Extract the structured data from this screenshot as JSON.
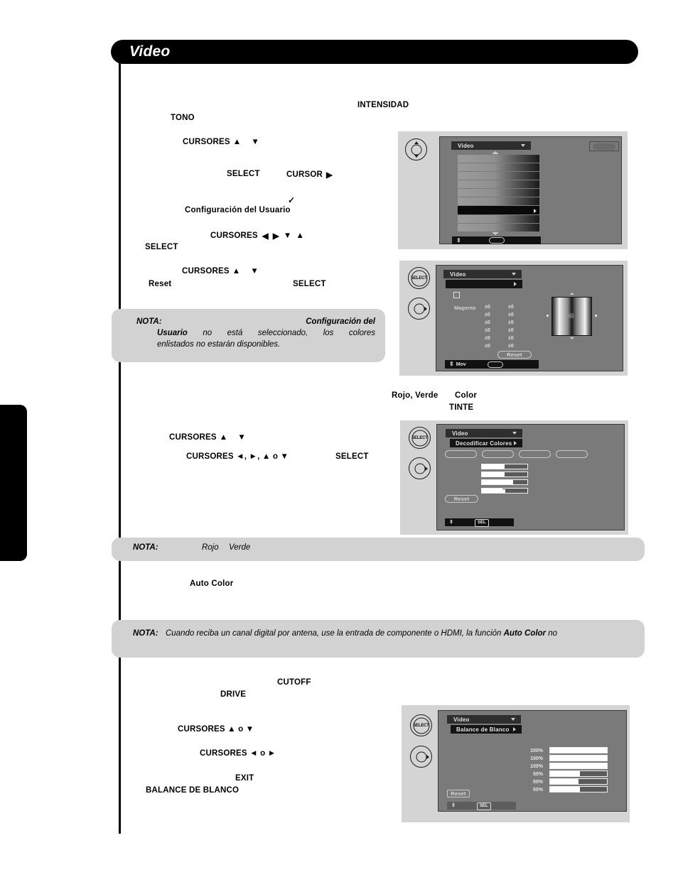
{
  "page": {
    "header_title": "Video"
  },
  "body_text": {
    "intensidad": "INTENSIDAD",
    "tono": "TONO",
    "cursores_ud_1": "CURSORES",
    "select_1": "SELECT",
    "cursor_right": "CURSOR",
    "check_mark": "✓",
    "config_usuario": "Configuración del Usuario",
    "cursores_lrdu": "CURSORES",
    "select_2": "SELECT",
    "cursores_ud_2": "CURSORES",
    "reset": "Reset",
    "select_3": "SELECT",
    "rojo_verde": "Rojo, Verde",
    "color": "Color",
    "tinte": "TINTE",
    "cursores_ud_3": "CURSORES",
    "cursores_mix": "CURSORES ◄, ►, ▲ o ▼",
    "select_4": "SELECT",
    "auto_color": "Auto Color",
    "cutoff": "CUTOFF",
    "drive": "DRIVE",
    "cursores_ud_4": "CURSORES ▲ o ▼",
    "cursores_lr": "CURSORES  ◄ o ►",
    "exit": "EXIT",
    "balance_de_blanco": "BALANCE DE BLANCO"
  },
  "notes": [
    {
      "label": "NOTA:",
      "line1_bold": "Configuración del",
      "line2_bold": "Usuario",
      "line2_rest": "no está seleccionado, los colores",
      "line3": "enlistados no estarán disponibles."
    },
    {
      "label": "NOTA:",
      "italic_1": "Rojo",
      "italic_2": "Verde"
    },
    {
      "label": "NOTA:",
      "text_a": "Cuando reciba un canal digital por antena, use la entrada de componente o HDMI, la función",
      "bold_b": "Auto Color",
      "text_c": "no"
    }
  ],
  "figures": [
    {
      "id": "fig-video-list",
      "remote_buttons": [
        {
          "type": "cursor-pad",
          "label": ""
        }
      ],
      "osd": {
        "title": "Video",
        "corner_button": "",
        "bottom_bar": {
          "icon": "move-updown-icon",
          "pill": ""
        },
        "rows": 9,
        "highlighted_row_index": 6
      }
    },
    {
      "id": "fig-color-management",
      "remote_buttons": [
        {
          "type": "select",
          "label": "SELECT"
        },
        {
          "type": "cursor-right",
          "label": ""
        }
      ],
      "osd": {
        "title": "Video",
        "sub": "",
        "magenta_label": "Magenta",
        "values_col1": [
          "±0",
          "±0",
          "±0",
          "±0",
          "±0",
          "±0"
        ],
        "values_col2": [
          "±0",
          "±0",
          "±0",
          "±0",
          "±0",
          "±0"
        ],
        "reset_label": "Reset",
        "bottom_bar": {
          "label": "Mov",
          "pill": ""
        }
      }
    },
    {
      "id": "fig-decodificar-colores",
      "remote_buttons": [
        {
          "type": "select",
          "label": "SELECT"
        },
        {
          "type": "cursor-right",
          "label": ""
        }
      ],
      "osd": {
        "title": "Video",
        "sub": "Decodificar Colores",
        "tabs": [
          "",
          "",
          "",
          ""
        ],
        "sliders": [
          {
            "value": 50
          },
          {
            "value": 50
          },
          {
            "value": 68
          },
          {
            "value": 49
          }
        ],
        "reset_label": "Reset",
        "bottom_bar": {
          "label": "SEL"
        }
      }
    },
    {
      "id": "fig-balance-de-blanco",
      "remote_buttons": [
        {
          "type": "select",
          "label": "SELECT"
        },
        {
          "type": "cursor-right",
          "label": ""
        }
      ],
      "osd": {
        "title": "Video",
        "sub": "Balance de Blanco",
        "rows": [
          {
            "pct": "100%",
            "value": 100
          },
          {
            "pct": "100%",
            "value": 100
          },
          {
            "pct": "100%",
            "value": 100
          },
          {
            "pct": "50%",
            "value": 53
          },
          {
            "pct": "50%",
            "value": 50
          },
          {
            "pct": "50%",
            "value": 53
          }
        ],
        "reset_label": "Reset",
        "bottom_bar": {
          "label": "SEL"
        }
      }
    }
  ],
  "colors": {
    "header_bg": "#000000",
    "note_bg": "#d2d2d2",
    "figure_bg": "#d4d4d4",
    "osd_screen": "#7a7a7a",
    "osd_title_bg": "#2e2e2e",
    "osd_sub_bg": "#141414"
  }
}
